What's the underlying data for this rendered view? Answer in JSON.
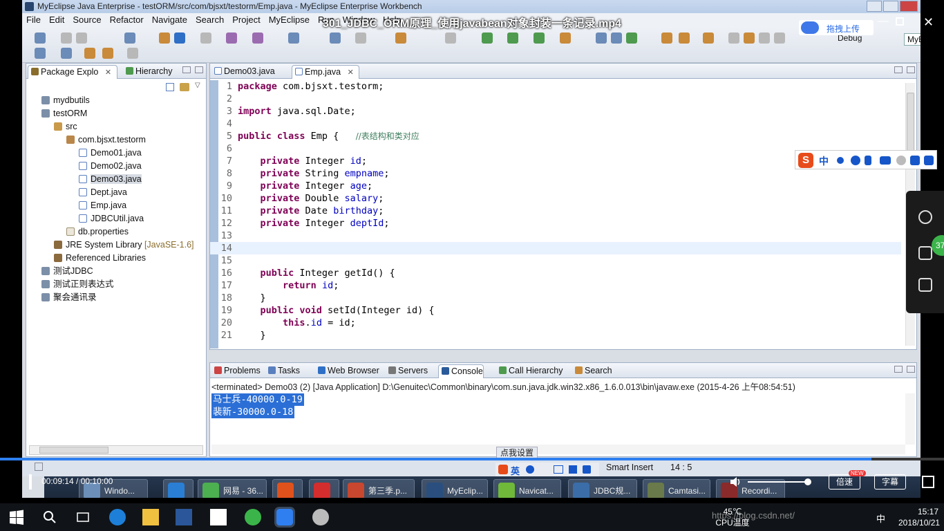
{
  "window": {
    "title": "MyEclipse Java Enterprise - testORM/src/com/bjsxt/testorm/Emp.java - MyEclipse Enterprise Workbench"
  },
  "video": {
    "title": "301_JDBC_ORM原理_使用javabean对象封装一条记录.mp4",
    "upload_label": "拖拽上传",
    "time": "00:09:14 / 00:10:00",
    "progress": 0.923,
    "speed_label": "倍速",
    "new_badge": "NEW",
    "subtitle_label": "字幕"
  },
  "menu": [
    "File",
    "Edit",
    "Source",
    "Refactor",
    "Navigate",
    "Search",
    "Project",
    "MyEclipse",
    "Run",
    "Window",
    "Help"
  ],
  "perspective": {
    "debug": "Debug",
    "myeclipse": "MyE"
  },
  "explorer": {
    "tabs": [
      "Package Explo",
      "Hierarchy"
    ],
    "tree": [
      {
        "label": "mydbutils",
        "indent": 1,
        "icon": "proj"
      },
      {
        "label": "testORM",
        "indent": 1,
        "icon": "proj"
      },
      {
        "label": "src",
        "indent": 2,
        "icon": "src"
      },
      {
        "label": "com.bjsxt.testorm",
        "indent": 3,
        "icon": "pkg"
      },
      {
        "label": "Demo01.java",
        "indent": 4,
        "icon": "java"
      },
      {
        "label": "Demo02.java",
        "indent": 4,
        "icon": "java"
      },
      {
        "label": "Demo03.java",
        "indent": 4,
        "icon": "java",
        "selected": true
      },
      {
        "label": "Dept.java",
        "indent": 4,
        "icon": "java"
      },
      {
        "label": "Emp.java",
        "indent": 4,
        "icon": "java"
      },
      {
        "label": "JDBCUtil.java",
        "indent": 4,
        "icon": "java"
      },
      {
        "label": "db.properties",
        "indent": 3,
        "icon": "file"
      },
      {
        "label": "JRE System Library",
        "decoration": "[JavaSE-1.6]",
        "indent": 2,
        "icon": "lib"
      },
      {
        "label": "Referenced Libraries",
        "indent": 2,
        "icon": "lib"
      },
      {
        "label": "测试JDBC",
        "indent": 1,
        "icon": "proj"
      },
      {
        "label": "测试正则表达式",
        "indent": 1,
        "icon": "proj"
      },
      {
        "label": "聚会通讯录",
        "indent": 1,
        "icon": "proj"
      }
    ]
  },
  "editor": {
    "tabs": [
      "Demo03.java",
      "Emp.java"
    ],
    "active_tab": 1,
    "current_line": 14,
    "lines": [
      {
        "n": "1",
        "html": "<span class=\"kw\">package</span> com.bjsxt.testorm;"
      },
      {
        "n": "2",
        "html": ""
      },
      {
        "n": "3",
        "html": "<span class=\"kw\">import</span> java.sql.Date;"
      },
      {
        "n": "4",
        "html": ""
      },
      {
        "n": "5",
        "html": "<span class=\"kw\">public class</span> Emp {   <span class=\"cmt\">//表结构和类对应</span>"
      },
      {
        "n": "6",
        "html": ""
      },
      {
        "n": "7",
        "html": "    <span class=\"kw\">private</span> Integer <span class=\"fld\">id</span>;"
      },
      {
        "n": "8",
        "html": "    <span class=\"kw\">private</span> String <span class=\"fld\">empname</span>;"
      },
      {
        "n": "9",
        "html": "    <span class=\"kw\">private</span> Integer <span class=\"fld\">age</span>;"
      },
      {
        "n": "10",
        "html": "    <span class=\"kw\">private</span> Double <span class=\"fld\">salary</span>;"
      },
      {
        "n": "11",
        "html": "    <span class=\"kw\">private</span> Date <span class=\"fld\">birthday</span>;"
      },
      {
        "n": "12",
        "html": "    <span class=\"kw\">private</span> Integer <span class=\"fld\">deptId</span>;"
      },
      {
        "n": "13",
        "html": ""
      },
      {
        "n": "14",
        "html": ""
      },
      {
        "n": "15",
        "html": ""
      },
      {
        "n": "16",
        "html": "    <span class=\"kw\">public</span> Integer getId() {"
      },
      {
        "n": "17",
        "html": "        <span class=\"kw\">return</span> <span class=\"fld\">id</span>;"
      },
      {
        "n": "18",
        "html": "    }"
      },
      {
        "n": "19",
        "html": "    <span class=\"kw\">public void</span> setId(Integer id) {"
      },
      {
        "n": "20",
        "html": "        <span class=\"kw\">this</span>.<span class=\"fld\">id</span> = id;"
      },
      {
        "n": "21",
        "html": "    }"
      }
    ]
  },
  "console": {
    "tabs": [
      "Problems",
      "Tasks",
      "Web Browser",
      "Servers",
      "Console",
      "Call Hierarchy",
      "Search"
    ],
    "active_tab": 4,
    "status": "<terminated> Demo03 (2) [Java Application] D:\\Genuitec\\Common\\binary\\com.sun.java.jdk.win32.x86_1.6.0.013\\bin\\javaw.exe (2015-4-26 上午08:54:51)",
    "output": [
      "马士兵-40000.0-19",
      "裴新-30000.0-18"
    ]
  },
  "statusbar": {
    "settings_label": "点我设置",
    "ime_label": "英",
    "insert_mode": "Smart Insert",
    "position": "14 : 5"
  },
  "sogou": {
    "zh": "中"
  },
  "sidebadge": "37",
  "oldtaskbar": [
    {
      "label": "Windo...",
      "color": "#6b8fb8"
    },
    {
      "label": "",
      "color": "#2a7fd4"
    },
    {
      "label": "网易 - 36...",
      "color": "#4caf50"
    },
    {
      "label": "",
      "color": "#e0521c"
    },
    {
      "label": "",
      "color": "#d42d2d"
    },
    {
      "label": "第三季.p...",
      "color": "#c8472e"
    },
    {
      "label": "MyEclip...",
      "color": "#2a4f7f"
    },
    {
      "label": "Navicat...",
      "color": "#6fb83a"
    },
    {
      "label": "JDBC规...",
      "color": "#3b6ea8"
    },
    {
      "label": "Camtasi...",
      "color": "#6a7a4a"
    },
    {
      "label": "Recordi...",
      "color": "#8a2a2a"
    }
  ],
  "taskbar": {
    "temp": "45℃",
    "temp_label": "CPU温度",
    "watermark": "https://blog.csdn.net/",
    "ime": "中",
    "time": "15:17",
    "date": "2018/10/21"
  }
}
